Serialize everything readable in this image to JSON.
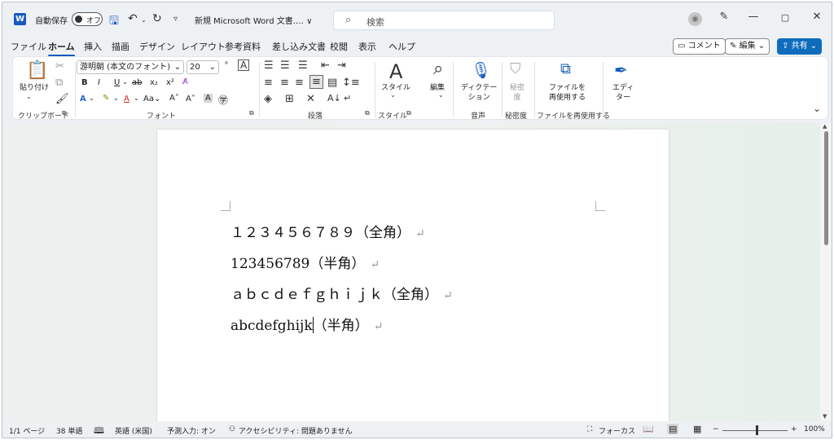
{
  "titlebar": {
    "autosave_label": "自動保存",
    "autosave_state": "オフ",
    "doc_title": "新規 Microsoft Word 文書.… ∨",
    "search_placeholder": "検索"
  },
  "menu": {
    "tabs": [
      "ファイル",
      "ホーム",
      "挿入",
      "描画",
      "デザイン",
      "レイアウト",
      "参考資料",
      "差し込み文書",
      "校閲",
      "表示",
      "ヘルプ"
    ],
    "active_tab": "ホーム",
    "comment_label": "コメント",
    "edit_label": "編集",
    "share_label": "共有"
  },
  "ribbon": {
    "paste_label": "貼り付け",
    "clipboard_label": "クリップボード",
    "font_name": "游明朝 (本文のフォント)",
    "font_size": "20",
    "font_label": "フォント",
    "paragraph_label": "段落",
    "style_label": "スタイル",
    "style_group_label": "スタイル",
    "edit_label": "編集",
    "dictate_label": "ディクテー\nション",
    "voice_label": "音声",
    "sensitivity_label": "秘密\n度",
    "sensitivity_group_label": "秘密度",
    "reuse_label": "ファイルを\n再使用する",
    "reuse_group_label": "ファイルを再使用する",
    "editor_label": "エディ\nター"
  },
  "document": {
    "lines": [
      "１２３４５６７８９（全角）",
      "123456789（半角）",
      "ａｂｃｄｅｆｇｈｉｊｋ（全角）",
      "abcdefghijk"
    ],
    "line4_tail": "（半角）",
    "pilcrow": "↵"
  },
  "statusbar": {
    "page": "1/1 ページ",
    "words": "38 単語",
    "language": "英語 (米国)",
    "ime": "予測入力: オン",
    "accessibility": "アクセシビリティ: 問題ありません",
    "focus": "フォーカス",
    "zoom": "100%"
  },
  "colors": {
    "accent": "#185abd",
    "share_button": "#0f6cbd"
  }
}
